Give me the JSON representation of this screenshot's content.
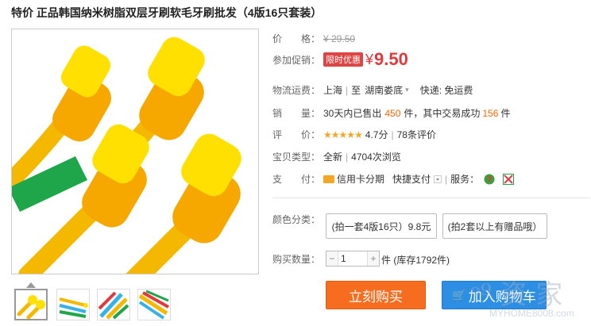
{
  "product": {
    "title": "特价 正品韩国纳米树脂双层牙刷软毛牙刷批发（4版16只套装）"
  },
  "price": {
    "label": "价　　格：",
    "original": "¥ 29.50"
  },
  "promo": {
    "label": "参加促销：",
    "tag": "限时优惠",
    "currency": "¥",
    "price": "9.50"
  },
  "shipping": {
    "label": "物流运费：",
    "from": "上海",
    "to_prefix": "至",
    "to": "湖南娄底",
    "fee": "快递: 免运费"
  },
  "sales": {
    "label": "销　　量：",
    "prefix": "30天内已售出",
    "sold": "450",
    "mid": "件，其中交易成功",
    "success": "156",
    "suffix": "件"
  },
  "rating": {
    "label": "评　　价：",
    "stars": "★★★★★",
    "score": "4.7分",
    "reviews": "78条评价"
  },
  "item_type": {
    "label": "宝贝类型：",
    "condition": "全新",
    "views": "4704次浏览"
  },
  "payment": {
    "label": "支　　付：",
    "credit": "信用卡分期",
    "quick": "快捷支付",
    "service_label": "服务："
  },
  "options": {
    "label": "颜色分类：",
    "items": [
      "(拍一套4版16只）9.8元",
      "(拍2套以上有赠品哦）"
    ]
  },
  "quantity": {
    "label": "购买数量：",
    "value": "1",
    "unit": "件",
    "stock": "(库存1792件)"
  },
  "actions": {
    "buy_now": "立刻购买",
    "add_to_cart": "加入购物车"
  },
  "watermark": {
    "text": "ᵒ⁹ 资 家",
    "sub": "MYHOME8008.com"
  },
  "colors": {
    "accent": "#e4393c",
    "orange": "#f60",
    "buy": "#f66d1f",
    "cart": "#2d8fe4"
  }
}
